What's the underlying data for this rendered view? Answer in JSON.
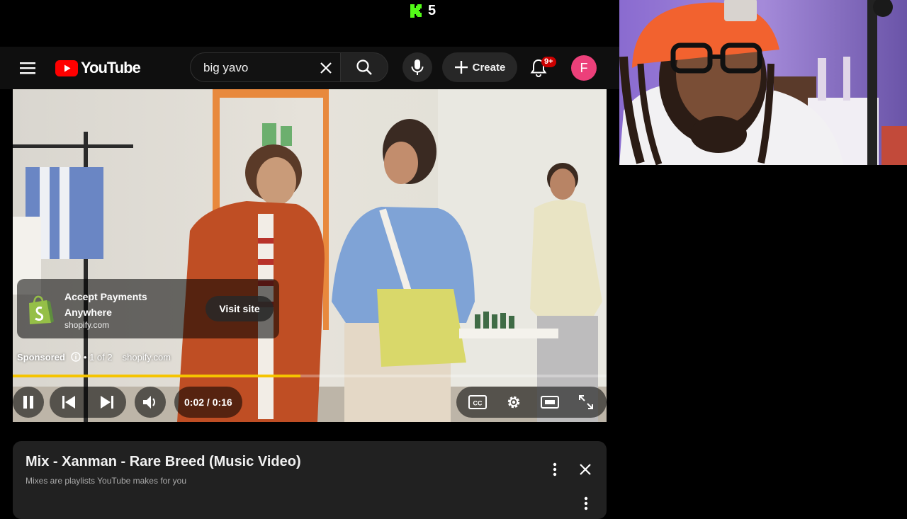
{
  "stream_overlay": {
    "kick_count": "5"
  },
  "header": {
    "logo_text": "YouTube",
    "search": {
      "value": "big yavo"
    },
    "create_label": "Create",
    "notification_badge": "9+",
    "avatar_letter": "F"
  },
  "ad": {
    "title": "Accept Payments Anywhere",
    "domain": "shopify.com",
    "visit_label": "Visit site",
    "sponsored_label": "Sponsored",
    "ad_count": "• 1 of 2",
    "sponsor_domain": "shopify.com",
    "brand_color": "#95bf47"
  },
  "player": {
    "time": "0:02 / 0:16",
    "progress": 0.485,
    "progress_color": "#f5c400"
  },
  "playlist": {
    "title": "Mix - Xanman - Rare Breed (Music Video)",
    "subtitle": "Mixes are playlists YouTube makes for you"
  },
  "colors": {
    "youtube_red": "#ff0000",
    "kick_green": "#53fc18",
    "avatar_bg": "#ec407a"
  }
}
